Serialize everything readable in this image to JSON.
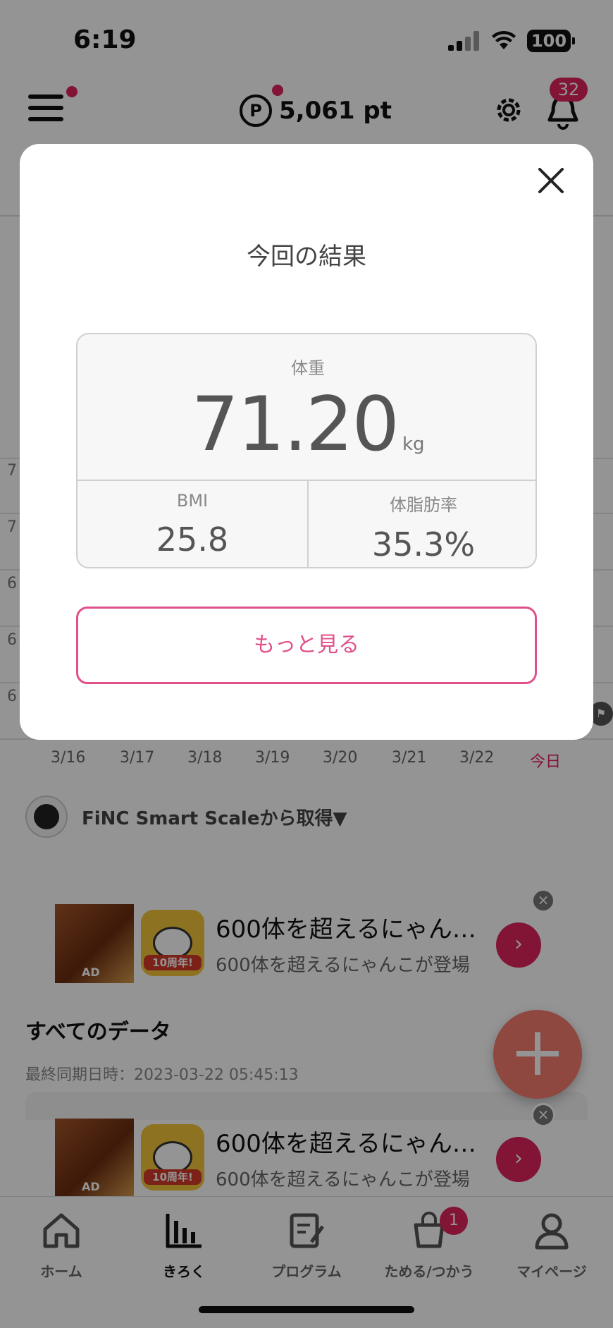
{
  "status_bar": {
    "time": "6:19",
    "battery": "100"
  },
  "header": {
    "points_icon": "P",
    "points": "5,061 pt",
    "notification_count": "32"
  },
  "chart": {
    "y_ticks": [
      "7",
      "7",
      "6",
      "6",
      "6"
    ],
    "x_ticks": [
      "3/16",
      "3/17",
      "3/18",
      "3/19",
      "3/20",
      "3/21",
      "3/22",
      "今日"
    ]
  },
  "source": {
    "text": "FiNC Smart Scaleから取得▼"
  },
  "ad": {
    "thumb_label": "AD",
    "icon_banner": "10周年!",
    "title": "600体を超えるにゃん…",
    "description": "600体を超えるにゃんこが登場",
    "go": "›",
    "close": "×"
  },
  "all_data": {
    "title": "すべてのデータ",
    "sync": "最終同期日時：2023-03-22 05:45:13"
  },
  "fab": {
    "label": "+"
  },
  "bottom_nav": {
    "items": [
      {
        "label": "ホーム",
        "icon": "home-icon"
      },
      {
        "label": "きろく",
        "icon": "bar-chart-icon"
      },
      {
        "label": "プログラム",
        "icon": "program-icon"
      },
      {
        "label": "ためる/つかう",
        "icon": "points-bag-icon",
        "badge": "1"
      },
      {
        "label": "マイページ",
        "icon": "person-icon"
      }
    ]
  },
  "modal": {
    "title": "今回の結果",
    "weight_label": "体重",
    "weight_value": "71.20",
    "weight_unit": "kg",
    "bmi_label": "BMI",
    "bmi_value": "25.8",
    "body_fat_label": "体脂肪率",
    "body_fat_value": "35.3%",
    "more_button": "もっと見る"
  },
  "colors": {
    "accent": "#e0245e",
    "button_outline": "#e0508a",
    "fab": "#f47d6f"
  }
}
